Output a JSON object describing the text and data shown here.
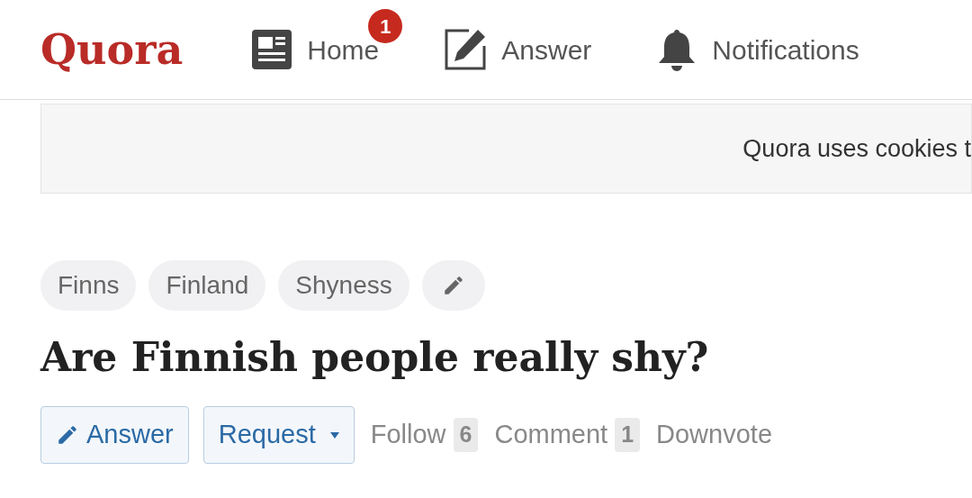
{
  "header": {
    "logo": "Quora",
    "nav": [
      {
        "kind": "home",
        "label": "Home",
        "badge": "1"
      },
      {
        "kind": "answer",
        "label": "Answer"
      },
      {
        "kind": "notifications",
        "label": "Notifications"
      }
    ]
  },
  "cookie_banner": {
    "text": "Quora uses cookies t"
  },
  "topics": [
    "Finns",
    "Finland",
    "Shyness"
  ],
  "question": {
    "title": "Are Finnish people really shy?"
  },
  "actions": [
    {
      "kind": "primary",
      "label": "Answer"
    },
    {
      "kind": "dropdown",
      "label": "Request"
    },
    {
      "kind": "count",
      "label": "Follow",
      "count": "6"
    },
    {
      "kind": "count",
      "label": "Comment",
      "count": "1"
    },
    {
      "kind": "plain",
      "label": "Downvote"
    }
  ]
}
